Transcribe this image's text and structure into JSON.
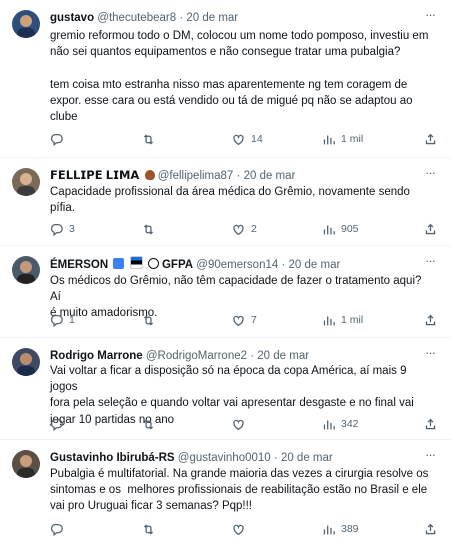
{
  "tweets": [
    {
      "name": "gustavo",
      "handle": "@thecutebear8",
      "dot": "·",
      "time": "20 de mar",
      "text": "gremio reformou todo o DM, colocou um nome todo pomposo, investiu em\nnão sei quantos equipamentos e não consegue tratar uma pubalgia?\n\ntem coisa mto estranha nisso mas aparentemente ng tem coragem de\nexpor. esse cara ou está vendido ou tá de migué pq não se adaptou ao\nclube",
      "replies": "",
      "retweets": "",
      "likes": "14",
      "views": "1 mil",
      "avatar_color": "#2f4f7a"
    },
    {
      "name": "𝗙𝗘𝗟𝗟𝗜𝗣𝗘 𝗟𝗜𝗠𝗔",
      "handle": "@fellipelima87",
      "dot": "·",
      "time": "20 de mar",
      "text": "Capacidade profissional da área médica do Grêmio, novamente sendo\npífia.",
      "replies": "3",
      "retweets": "",
      "likes": "2",
      "views": "905",
      "avatar_color": "#7a6a58"
    },
    {
      "name": "ÉMERSON",
      "handle": "@90emerson14",
      "dot": "·",
      "time": "20 de mar",
      "suffix": "GFPA",
      "text": "Os médicos do Grêmio, não têm capacidade de fazer o tratamento aqui? Aí\né muito amadorismo.",
      "replies": "1",
      "retweets": "",
      "likes": "7",
      "views": "1 mil",
      "avatar_color": "#4a5a6a"
    },
    {
      "name": "Rodrigo Marrone",
      "handle": "@RodrigoMarrone2",
      "dot": "·",
      "time": "20 de mar",
      "text": "Vai voltar a ficar a disposição só na época da copa América, aí mais 9 jogos\nfora pela seleção e quando voltar vai apresentar desgaste e no final vai\njogar 10 partidas no ano",
      "replies": "",
      "retweets": "",
      "likes": "",
      "views": "342",
      "avatar_color": "#3d4a66"
    },
    {
      "name": "Gustavinho Ibirubá-RS",
      "handle": "@gustavinho0010",
      "dot": "·",
      "time": "20 de mar",
      "text": "Pubalgia é multifatorial. Na grande maioria das vezes a cirurgia resolve os\nsintomas e os  melhores profissionais de reabilitação estão no Brasil e ele\nvai pro Uruguai ficar 3 semanas? Pqp!!!",
      "replies": "",
      "retweets": "",
      "likes": "",
      "views": "389",
      "avatar_color": "#5a5048"
    }
  ],
  "colors": {
    "text": "#0f1419",
    "secondary": "#536471",
    "divider": "#eff3f4"
  },
  "icons": [
    "reply-icon",
    "retweet-icon",
    "like-icon",
    "views-icon",
    "share-icon",
    "more-icon"
  ]
}
